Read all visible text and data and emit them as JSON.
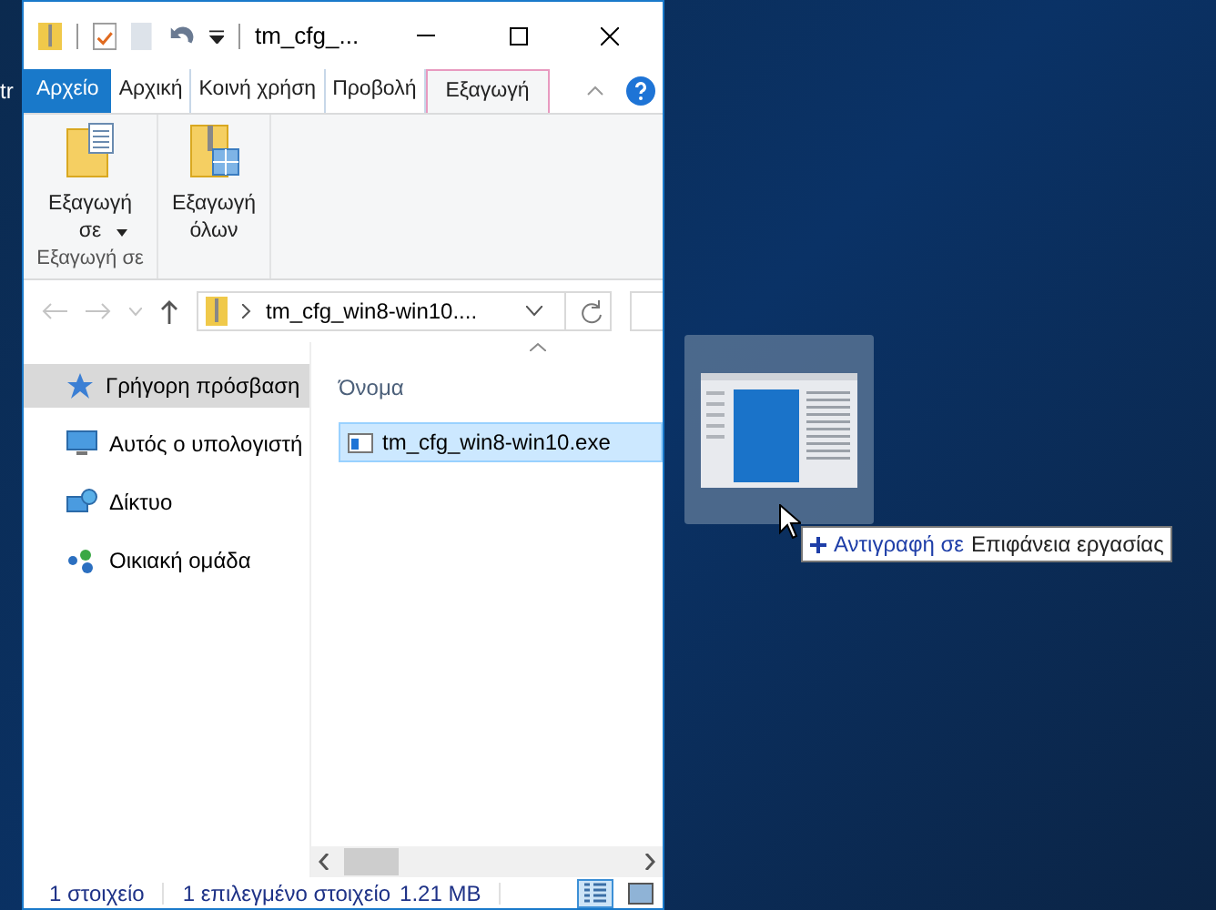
{
  "desktop": {
    "icon_label": "tr"
  },
  "window": {
    "title": "tm_cfg_..."
  },
  "tabs": [
    {
      "label": "Αρχείο",
      "kind": "file",
      "selected": false
    },
    {
      "label": "Αρχική",
      "kind": "normal",
      "selected": false
    },
    {
      "label": "Κοινή χρήση",
      "kind": "normal",
      "selected": false
    },
    {
      "label": "Προβολή",
      "kind": "normal",
      "selected": false
    },
    {
      "label": "Εξαγωγή",
      "kind": "normal",
      "selected": true
    }
  ],
  "ribbon": {
    "buttons": [
      {
        "label": "Εξαγωγή σε",
        "dropdown": true
      },
      {
        "label": "Εξαγωγή όλων",
        "dropdown": false
      }
    ],
    "group_label": "Εξαγωγή σε"
  },
  "address_bar": {
    "path": "tm_cfg_win8-win10...."
  },
  "sidebar": {
    "items": [
      {
        "label": "Γρήγορη πρόσβαση",
        "kind": "star",
        "selected": true
      },
      {
        "label": "Αυτός ο υπολογιστή",
        "kind": "pc",
        "selected": false
      },
      {
        "label": "Δίκτυο",
        "kind": "network",
        "selected": false
      },
      {
        "label": "Οικιακή ομάδα",
        "kind": "group",
        "selected": false
      }
    ]
  },
  "file_list": {
    "columns": [
      "Όνομα"
    ],
    "rows": [
      {
        "name": "tm_cfg_win8-win10.exe",
        "selected": true
      }
    ]
  },
  "status_bar": {
    "count": "1 στοιχείο",
    "selection": "1 επιλεγμένο στοιχείο",
    "size": "1.21 MB",
    "views": [
      {
        "kind": "details",
        "selected": true
      },
      {
        "kind": "tiles",
        "selected": false
      }
    ]
  },
  "drag_tooltip": {
    "action": "Αντιγραφή σε",
    "target": "Επιφάνεια εργασίας"
  }
}
